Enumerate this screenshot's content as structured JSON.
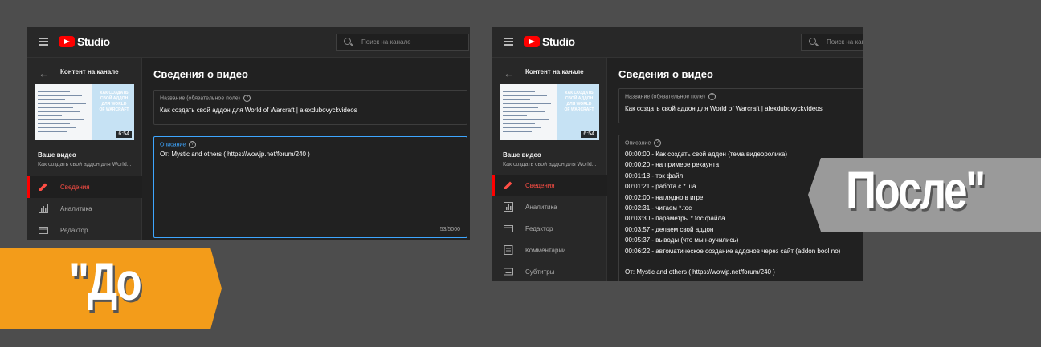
{
  "colors": {
    "background": "#4d4d4d",
    "accent_red": "#ff0000",
    "focus_blue": "#3ea6ff",
    "before_banner": "#f39c1a",
    "after_banner": "#9a9a9a"
  },
  "studio": {
    "logo_text": "Studio",
    "search_placeholder": "Поиск на канале",
    "sidebar_title": "Контент на канале",
    "thumbnail_caption": "КАК СОЗДАТЬ СВОЙ АДДОН ДЛЯ WORLD OF WARCRAFT",
    "duration": "6:54",
    "your_video_label": "Ваше видео",
    "video_title_short": "Как создать свой аддон для World...",
    "page_heading": "Сведения о видео",
    "title_field_label": "Название (обязательное поле)",
    "title_value": "Как создать свой аддон для World of Warcraft | alexdubovyckvideos",
    "description_label": "Описание"
  },
  "before": {
    "nav": [
      "Сведения",
      "Аналитика",
      "Редактор"
    ],
    "description": "От: Mystic and others ( https://wowjp.net/forum/240 )",
    "counter": "53/5000",
    "banner_text": "\"До"
  },
  "after": {
    "nav": [
      "Сведения",
      "Аналитика",
      "Редактор",
      "Комментарии",
      "Субтитры"
    ],
    "description_lines": [
      "00:00:00 - Как создать свой аддон (тема видеоролика)",
      "00:00:20 - на примере рекаунта",
      "00:01:18 - ток файл",
      "00:01:21 - работа с *.lua",
      "00:02:00 - наглядно в игре",
      "00:02:31 - читаем *.toc",
      "00:03:30 - параметры *.toc файла",
      "00:03:57 - делаем свой аддон",
      "00:05:37 - выводы (что мы научились)",
      "00:06:22 - автоматическое создание аддонов через сайт (addon bool no)",
      "",
      "От: Mystic and others ( https://wowjp.net/forum/240 )"
    ],
    "banner_text": "После\""
  }
}
